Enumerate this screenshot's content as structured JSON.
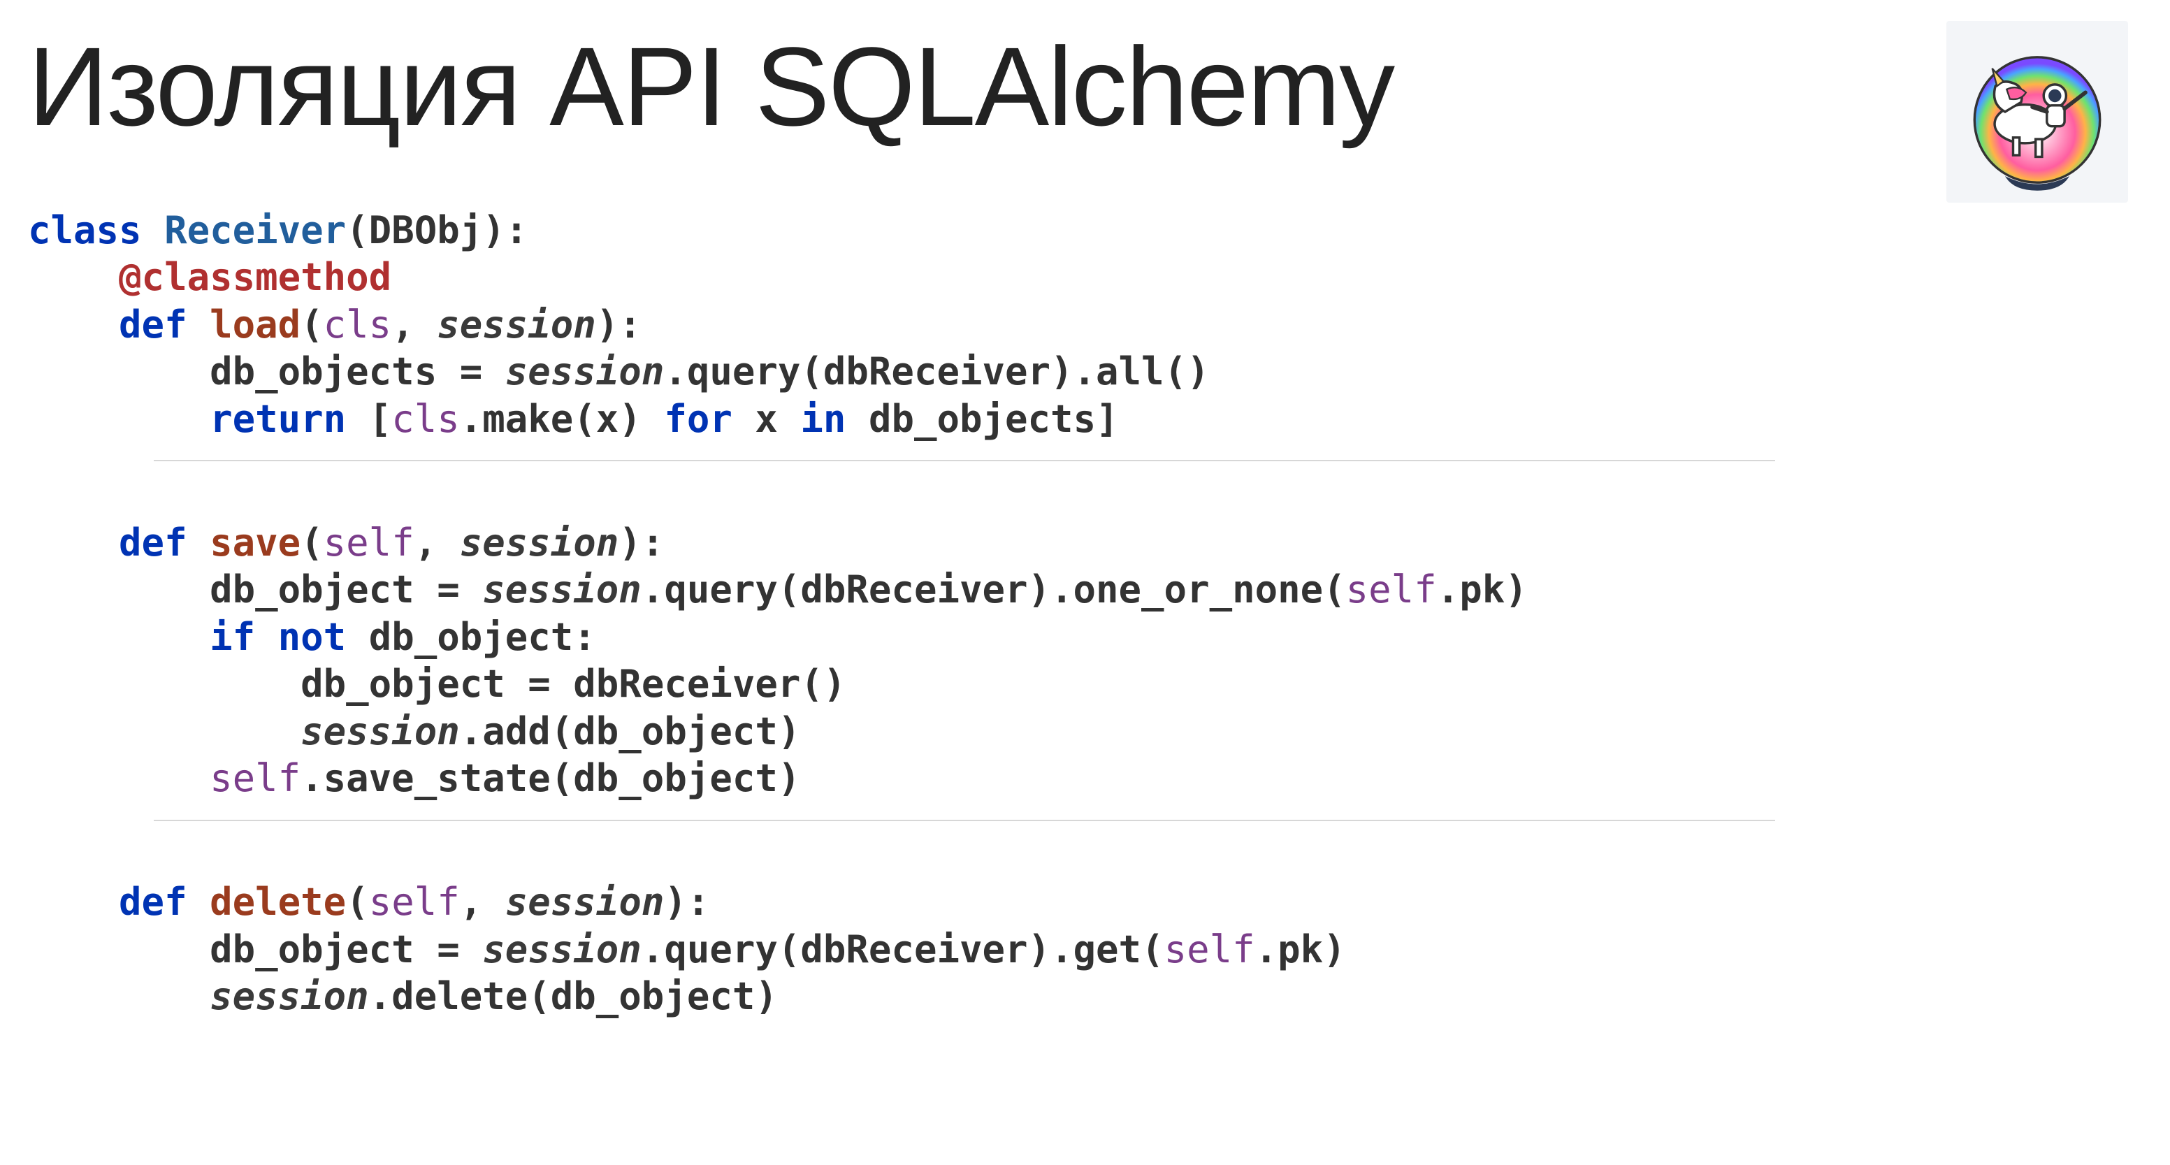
{
  "title": "Изоляция API SQLAlchemy",
  "logo_name": "unicorn-astronaut-icon",
  "code": {
    "l1": {
      "kw1": "class ",
      "cls": "Receiver",
      "p1": "(DBObj):"
    },
    "l2": {
      "dec": "@classmethod"
    },
    "l3": {
      "kw": "def ",
      "fn": "load",
      "p1": "(",
      "self": "cls",
      "c": ", ",
      "arg": "session",
      "p2": "):"
    },
    "l4": {
      "v": "db_objects ",
      "op": "= ",
      "arg": "session",
      "tail": ".query(dbReceiver).all()"
    },
    "l5": {
      "kw1": "return ",
      "p1": "[",
      "self": "cls",
      "mk": ".make(x) ",
      "kw2": "for ",
      "x": "x ",
      "kw3": "in ",
      "tail": "db_objects]"
    },
    "l6": {
      "kw": "def ",
      "fn": "save",
      "p1": "(",
      "self": "self",
      "c": ", ",
      "arg": "session",
      "p2": "):"
    },
    "l7": {
      "v": "db_object ",
      "op": "= ",
      "arg": "session",
      "q": ".query(dbReceiver).one_or_none(",
      "self": "self",
      "tail": ".pk)"
    },
    "l8": {
      "kw1": "if ",
      "kw2": "not ",
      "tail": "db_object:"
    },
    "l9": {
      "v": "db_object ",
      "op": "= ",
      "tail": "dbReceiver()"
    },
    "l10": {
      "arg": "session",
      "tail": ".add(db_object)"
    },
    "l11": {
      "self": "self",
      "tail": ".save_state(db_object)"
    },
    "l12": {
      "kw": "def ",
      "fn": "delete",
      "p1": "(",
      "self": "self",
      "c": ", ",
      "arg": "session",
      "p2": "):"
    },
    "l13": {
      "v": "db_object ",
      "op": "= ",
      "arg": "session",
      "q": ".query(dbReceiver).get(",
      "self": "self",
      "tail": ".pk)"
    },
    "l14": {
      "arg": "session",
      "tail": ".delete(db_object)"
    }
  }
}
